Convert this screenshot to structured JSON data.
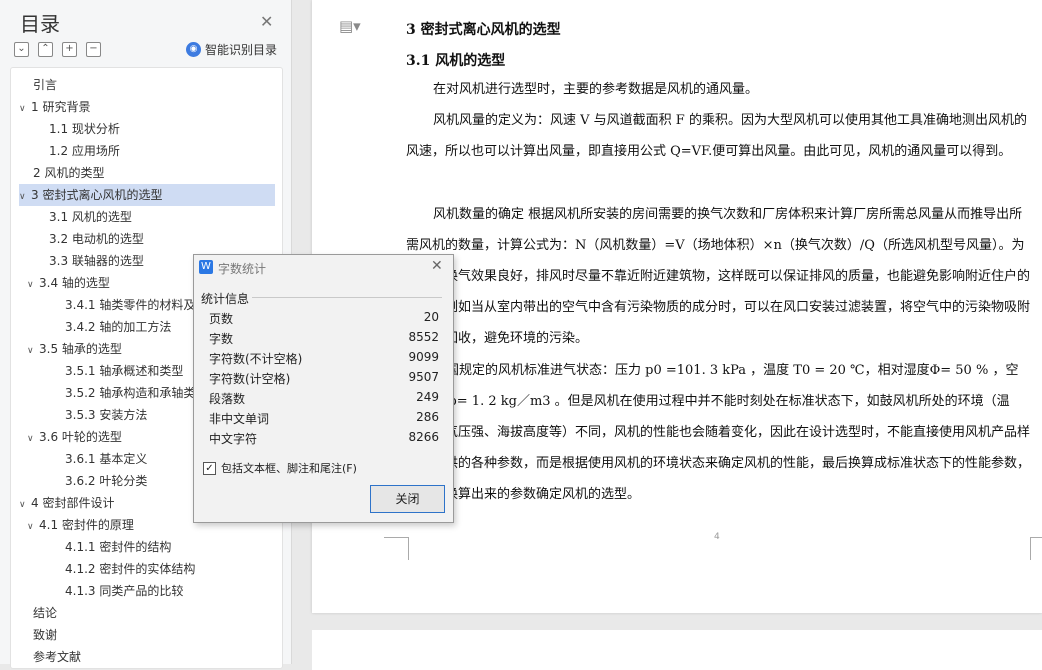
{
  "sidebar": {
    "title": "目录",
    "smart_toc": "智能识别目录",
    "toc": [
      {
        "label": "引言",
        "level": 1,
        "has_children": false
      },
      {
        "label": "1 研究背景",
        "level": 1,
        "has_children": true
      },
      {
        "label": "1.1 现状分析",
        "level": 2,
        "has_children": false
      },
      {
        "label": "1.2  应用场所",
        "level": 2,
        "has_children": false
      },
      {
        "label": "2 风机的类型",
        "level": 1,
        "has_children": false
      },
      {
        "label": "3 密封式离心风机的选型",
        "level": 1,
        "has_children": true,
        "selected": true
      },
      {
        "label": "3.1 风机的选型",
        "level": 2,
        "has_children": false
      },
      {
        "label": "3.2 电动机的选型",
        "level": 2,
        "has_children": false
      },
      {
        "label": "3.3 联轴器的选型",
        "level": 2,
        "has_children": false
      },
      {
        "label": "3.4 轴的选型",
        "level": 2,
        "has_children": true
      },
      {
        "label": "3.4.1 轴类零件的材料及",
        "level": 3,
        "has_children": false
      },
      {
        "label": "3.4.2 轴的加工方法",
        "level": 3,
        "has_children": false
      },
      {
        "label": "3.5  轴承的选型",
        "level": 2,
        "has_children": true
      },
      {
        "label": "3.5.1 轴承概述和类型",
        "level": 3,
        "has_children": false
      },
      {
        "label": "3.5.2 轴承构造和承轴类",
        "level": 3,
        "has_children": false
      },
      {
        "label": "3.5.3 安装方法",
        "level": 3,
        "has_children": false
      },
      {
        "label": "3.6 叶轮的选型",
        "level": 2,
        "has_children": true
      },
      {
        "label": "3.6.1 基本定义",
        "level": 3,
        "has_children": false
      },
      {
        "label": "3.6.2 叶轮分类",
        "level": 3,
        "has_children": false
      },
      {
        "label": "4 密封部件设计",
        "level": 1,
        "has_children": true
      },
      {
        "label": "4.1 密封件的原理",
        "level": 2,
        "has_children": true
      },
      {
        "label": "4.1.1 密封件的结构",
        "level": 3,
        "has_children": false
      },
      {
        "label": "4.1.2 密封件的实体结构",
        "level": 3,
        "has_children": false
      },
      {
        "label": "4.1.3 同类产品的比较",
        "level": 3,
        "has_children": false
      },
      {
        "label": "结论",
        "level": 1,
        "has_children": false
      },
      {
        "label": "致谢",
        "level": 1,
        "has_children": false
      },
      {
        "label": "参考文献",
        "level": 1,
        "has_children": false
      }
    ]
  },
  "document": {
    "heading1": "3 密封式离心风机的选型",
    "heading2": "3.1 风机的选型",
    "paragraphs": [
      "在对风机进行选型时，主要的参考数据是风机的通风量。",
      "风机风量的定义为：风速 V 与风道截面积 F 的乘积。因为大型风机可以使用其他工具准确地测出风机的风速，所以也可以计算出风量，即直接用公式 Q=VF.便可算出风量。由此可见，风机的通风量可以得到。",
      "风机数量的确定 根据风机所安装的房间需要的换气次数和厂房体积来计算厂房所需总风量从而推导出所需风机的数量，计算公式为：N（风机数量）=V（场地体积）×n（换气次数）/Q（所选风机型号风量）。为了通风换气效果良好，排风时尽量不靠近附近建筑物，这样既可以保证排风的质量，也能避免影响附近住户的生活。例如当从室内带出的空气中含有污染物质的成分时，可以在风口安装过滤装置，将空气中的污染物吸附并集中回收，避免环境的污染。",
      "我国规定的风机标准进气状态：压力 p0 =101. 3 kPa ，温度 T0 = 20 ℃，相对湿度Φ= 50 % ，空气密度 ρ= 1. 2 kg／m3 。但是风机在使用过程中并不能时刻处在标准状态下，如鼓风机所处的环境（温度、大气压强、海拔高度等）不同，风机的性能也会随着变化，因此在设计选型时，不能直接使用风机产品样本上提供的各种参数，而是根据使用风机的环境状态来确定风机的性能，最后换算成标准状态下的性能参数，再根据换算出来的参数确定风机的选型。"
    ],
    "page_number": "4"
  },
  "dialog": {
    "title": "字数统计",
    "group_label": "统计信息",
    "stats": [
      {
        "label": "页数",
        "value": "20"
      },
      {
        "label": "字数",
        "value": "8552"
      },
      {
        "label": "字符数(不计空格)",
        "value": "9099"
      },
      {
        "label": "字符数(计空格)",
        "value": "9507"
      },
      {
        "label": "段落数",
        "value": "249"
      },
      {
        "label": "非中文单词",
        "value": "286"
      },
      {
        "label": "中文字符",
        "value": "8266"
      }
    ],
    "checkbox_label": "包括文本框、脚注和尾注(F)",
    "checkbox_checked": true,
    "close_label": "关闭"
  }
}
